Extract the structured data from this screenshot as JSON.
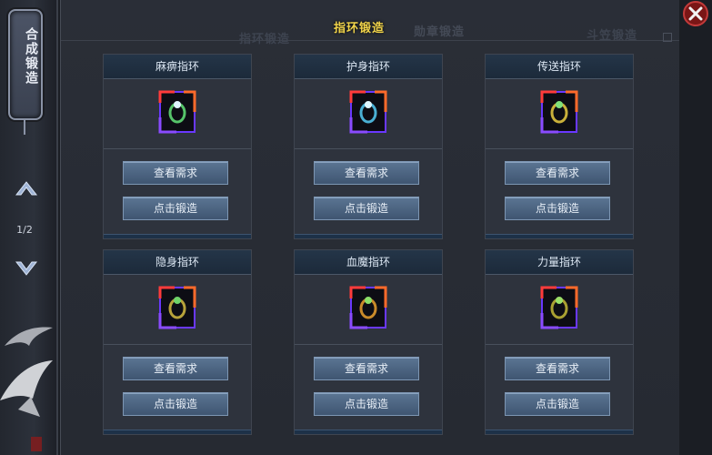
{
  "sidebar": {
    "title": "合成锻造",
    "page": "1/2"
  },
  "tabs": [
    "指环锻造",
    "指环锻造",
    "勋章锻造",
    "斗笠锻造"
  ],
  "cards": [
    {
      "name": "麻痹指环",
      "check": "查看需求",
      "forge": "点击锻造"
    },
    {
      "name": "护身指环",
      "check": "查看需求",
      "forge": "点击锻造"
    },
    {
      "name": "传送指环",
      "check": "查看需求",
      "forge": "点击锻造"
    },
    {
      "name": "隐身指环",
      "check": "查看需求",
      "forge": "点击锻造"
    },
    {
      "name": "血魔指环",
      "check": "查看需求",
      "forge": "点击锻造"
    },
    {
      "name": "力量指环",
      "check": "查看需求",
      "forge": "点击锻造"
    }
  ],
  "icons": {
    "arrow_up": "chevron-up-icon",
    "arrow_down": "chevron-down-icon",
    "close": "close-icon",
    "ring": "ring-icon"
  },
  "colors": {
    "active_tab": "#f0d34a",
    "button": "#4e6784",
    "header": "#1f3044"
  }
}
